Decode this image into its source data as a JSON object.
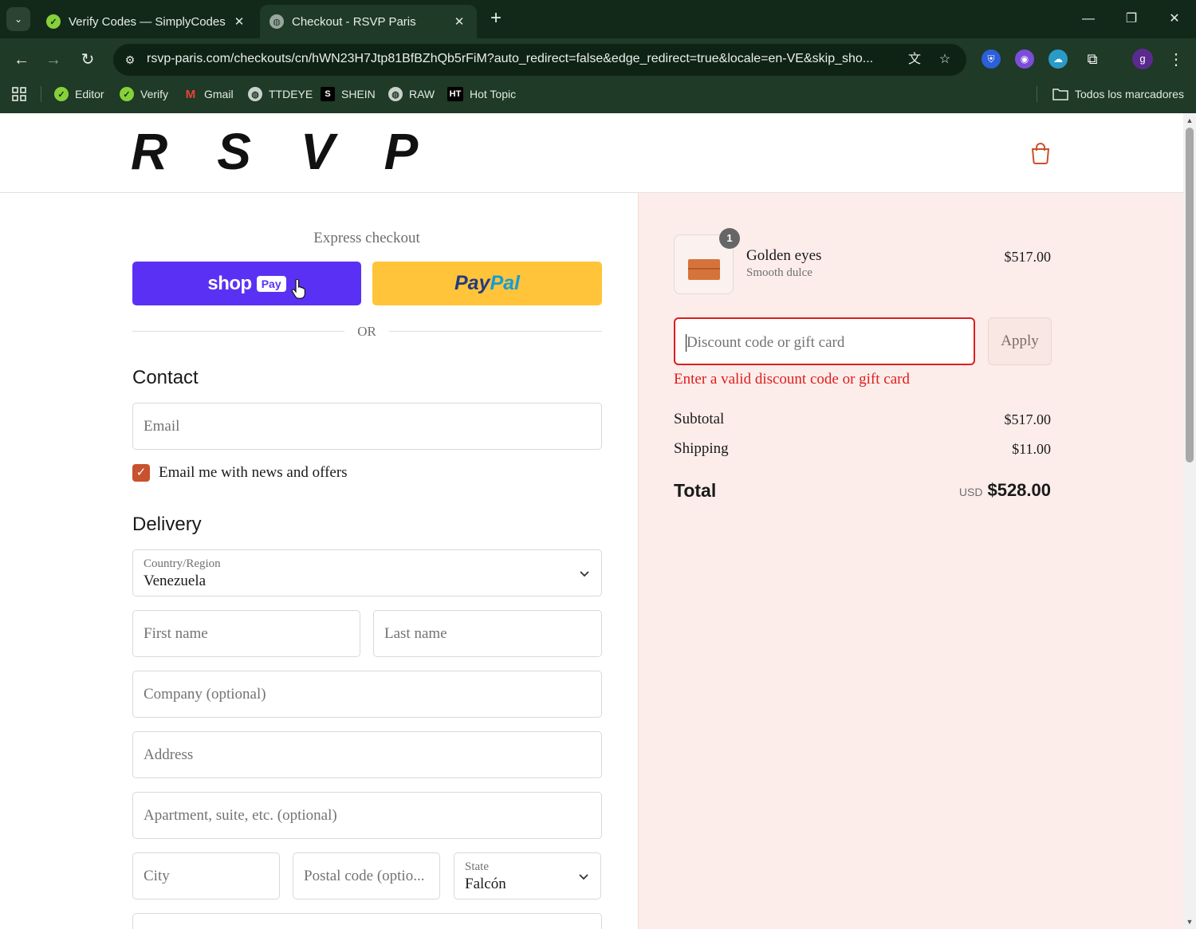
{
  "browser": {
    "tabs": [
      {
        "title": "Verify Codes — SimplyCodes",
        "active": false
      },
      {
        "title": "Checkout - RSVP Paris",
        "active": true
      }
    ],
    "url": "rsvp-paris.com/checkouts/cn/hWN23H7Jtp81BfBZhQb5rFiM?auto_redirect=false&edge_redirect=true&locale=en-VE&skip_sho...",
    "bookmarks": [
      "Editor",
      "Verify",
      "Gmail",
      "TTDEYE",
      "SHEIN",
      "RAW",
      "Hot Topic"
    ],
    "bookmark_icons": {
      "ttdeye": "globe-icon",
      "shein": "S",
      "raw": "globe-icon",
      "hottopic": "HT"
    },
    "all_bookmarks": "Todos los marcadores",
    "profile_initial": "g"
  },
  "store": {
    "logo": "RSVP"
  },
  "checkout": {
    "express_title": "Express checkout",
    "shoppay_word": "shop",
    "shoppay_pay": "Pay",
    "paypal_a": "Pay",
    "paypal_b": "Pal",
    "or_text": "OR",
    "contact": {
      "title": "Contact",
      "email_placeholder": "Email",
      "newsletter_label": "Email me with news and offers",
      "newsletter_checked": true
    },
    "delivery": {
      "title": "Delivery",
      "country_label": "Country/Region",
      "country_value": "Venezuela",
      "first_name": "First name",
      "last_name": "Last name",
      "company": "Company (optional)",
      "address": "Address",
      "apartment": "Apartment, suite, etc. (optional)",
      "city": "City",
      "postal": "Postal code (optio...",
      "state_label": "State",
      "state_value": "Falcón"
    }
  },
  "summary": {
    "item": {
      "quantity": "1",
      "name": "Golden eyes",
      "variant": "Smooth dulce",
      "price": "$517.00"
    },
    "discount_placeholder": "Discount code or gift card",
    "apply_label": "Apply",
    "error": "Enter a valid discount code or gift card",
    "subtotal_label": "Subtotal",
    "subtotal_value": "$517.00",
    "shipping_label": "Shipping",
    "shipping_value": "$11.00",
    "total_label": "Total",
    "total_currency": "USD",
    "total_value": "$528.00"
  },
  "colors": {
    "chrome": "#1f3a26",
    "shoppay": "#5a31f4",
    "paypal": "#ffc439",
    "accent": "#c8512e",
    "error": "#dd1d1d",
    "summary_bg": "#fcedea"
  }
}
